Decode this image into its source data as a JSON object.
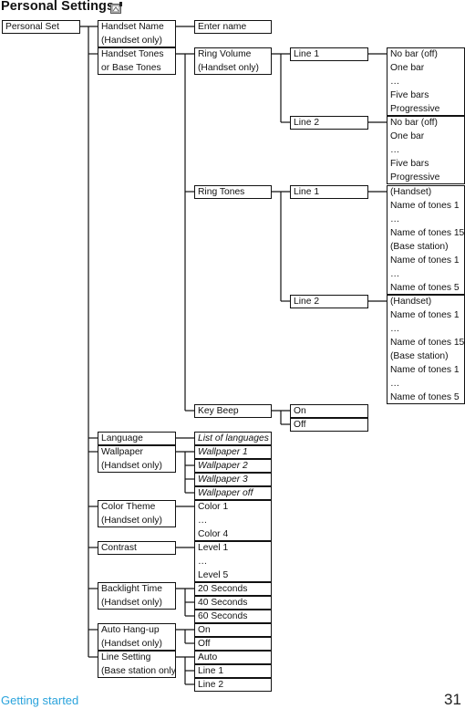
{
  "title": "Personal Settings",
  "title_icon": "personal-settings-icon",
  "footer": {
    "section": "Getting started",
    "page": "31",
    "section_color": "#2aa3dc"
  },
  "menu": {
    "root": [
      "Personal Set"
    ],
    "handset_name": [
      "Handset Name",
      "(Handset only)"
    ],
    "enter_name": [
      "Enter name"
    ],
    "handset_tones": [
      "Handset Tones",
      "or Base Tones"
    ],
    "ring_volume": [
      "Ring Volume",
      "(Handset only)"
    ],
    "rv_line1": [
      "Line 1"
    ],
    "rv_line1_opts": [
      "No bar (off)",
      "One bar",
      "…",
      "Five bars",
      "Progressive"
    ],
    "rv_line2": [
      "Line 2"
    ],
    "rv_line2_opts": [
      "No bar (off)",
      "One bar",
      "…",
      "Five bars",
      "Progressive"
    ],
    "ring_tones": [
      "Ring Tones"
    ],
    "rt_line1": [
      "Line 1"
    ],
    "rt_line1_opts": [
      "(Handset)",
      "Name of tones 1",
      "…",
      "Name of tones 15",
      "(Base station)",
      "Name of tones 1",
      "…",
      "Name of tones 5"
    ],
    "rt_line2": [
      "Line 2"
    ],
    "rt_line2_opts": [
      "(Handset)",
      "Name of tones 1",
      "…",
      "Name of tones 15",
      "(Base station)",
      "Name of tones 1",
      "…",
      "Name of tones 5"
    ],
    "key_beep": [
      "Key Beep"
    ],
    "key_beep_on": [
      "On"
    ],
    "key_beep_off": [
      "Off"
    ],
    "language": [
      "Language"
    ],
    "language_list": [
      "List of languages"
    ],
    "wallpaper": [
      "Wallpaper",
      "(Handset only)"
    ],
    "wallpaper_1": [
      "Wallpaper 1"
    ],
    "wallpaper_2": [
      "Wallpaper 2"
    ],
    "wallpaper_3": [
      "Wallpaper 3"
    ],
    "wallpaper_off": [
      "Wallpaper off"
    ],
    "color_theme": [
      "Color Theme",
      "(Handset only)"
    ],
    "color_opts": [
      "Color 1",
      "…",
      "Color 4"
    ],
    "contrast": [
      "Contrast"
    ],
    "contrast_opts": [
      "Level 1",
      "…",
      "Level 5"
    ],
    "backlight": [
      "Backlight Time",
      "(Handset only)"
    ],
    "backlight_20": [
      "20 Seconds"
    ],
    "backlight_40": [
      "40 Seconds"
    ],
    "backlight_60": [
      "60 Seconds"
    ],
    "auto_hangup": [
      "Auto Hang-up",
      "(Handset only)"
    ],
    "auto_hangup_on": [
      "On"
    ],
    "auto_hangup_off": [
      "Off"
    ],
    "line_setting": [
      "Line Setting",
      "(Base station only)"
    ],
    "line_setting_auto": [
      "Auto"
    ],
    "line_setting_line1": [
      "Line 1"
    ],
    "line_setting_line2": [
      "Line 2"
    ]
  }
}
